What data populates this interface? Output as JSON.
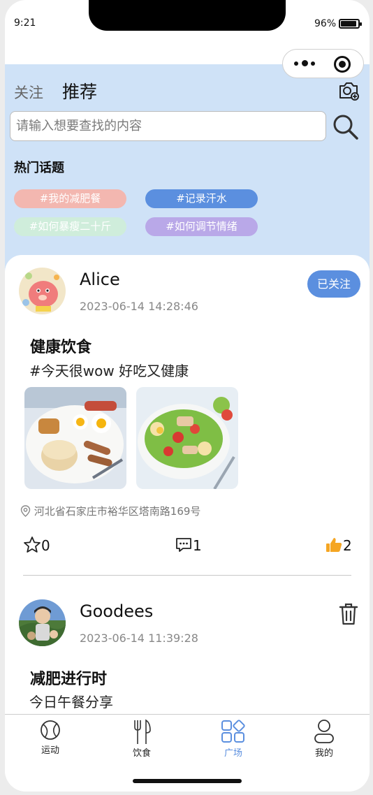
{
  "status_bar": {
    "time": "9:21",
    "battery": "96%"
  },
  "header": {
    "tab_follow": "关注",
    "tab_recommend": "推荐",
    "search_placeholder": "请输入想要查找的内容",
    "hot_topics_title": "热门话题",
    "topics": [
      {
        "label": "#我的减肥餐",
        "color": "#f3b7b0"
      },
      {
        "label": "#记录汗水",
        "color": "#5b8fdf"
      },
      {
        "label": "#如何暴瘦二十斤",
        "color": "#cfeddb"
      },
      {
        "label": "#如何调节情绪",
        "color": "#b9a8e8"
      }
    ]
  },
  "posts": [
    {
      "author": "Alice",
      "time": "2023-06-14 14:28:46",
      "follow_label": "已关注",
      "title": "健康饮食",
      "body": "#今天很wow 好吃又健康",
      "location": "河北省石家庄市裕华区塔南路169号",
      "favorites": "0",
      "comments": "1",
      "likes": "2"
    },
    {
      "author": "Goodees",
      "time": "2023-06-14 11:39:28",
      "title": "减肥进行时",
      "body": "今日午餐分享"
    }
  ],
  "tabbar": {
    "items": [
      {
        "label": "运动",
        "icon": "sport-ball-icon"
      },
      {
        "label": "饮食",
        "icon": "fork-knife-icon"
      },
      {
        "label": "广场",
        "icon": "square-grid-icon"
      },
      {
        "label": "我的",
        "icon": "user-icon"
      }
    ],
    "active_color": "#5b8fdf"
  }
}
